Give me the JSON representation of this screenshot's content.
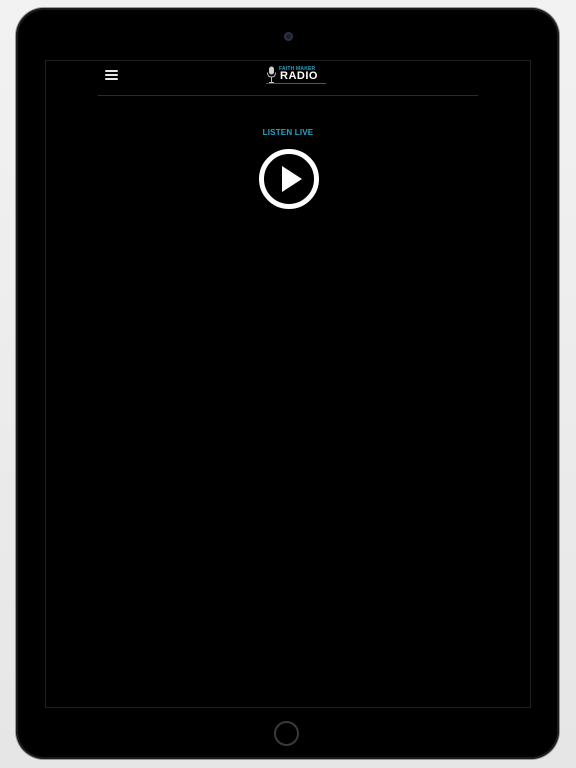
{
  "app": {
    "logo": {
      "top_text": "FAITH MAKER",
      "main_text": "RADIO"
    },
    "menu_icon": "hamburger-menu-icon"
  },
  "player": {
    "title": "LISTEN LIVE",
    "play_icon": "play-icon"
  },
  "colors": {
    "accent": "#21a7c9",
    "background": "#000000",
    "icon": "#ffffff"
  }
}
